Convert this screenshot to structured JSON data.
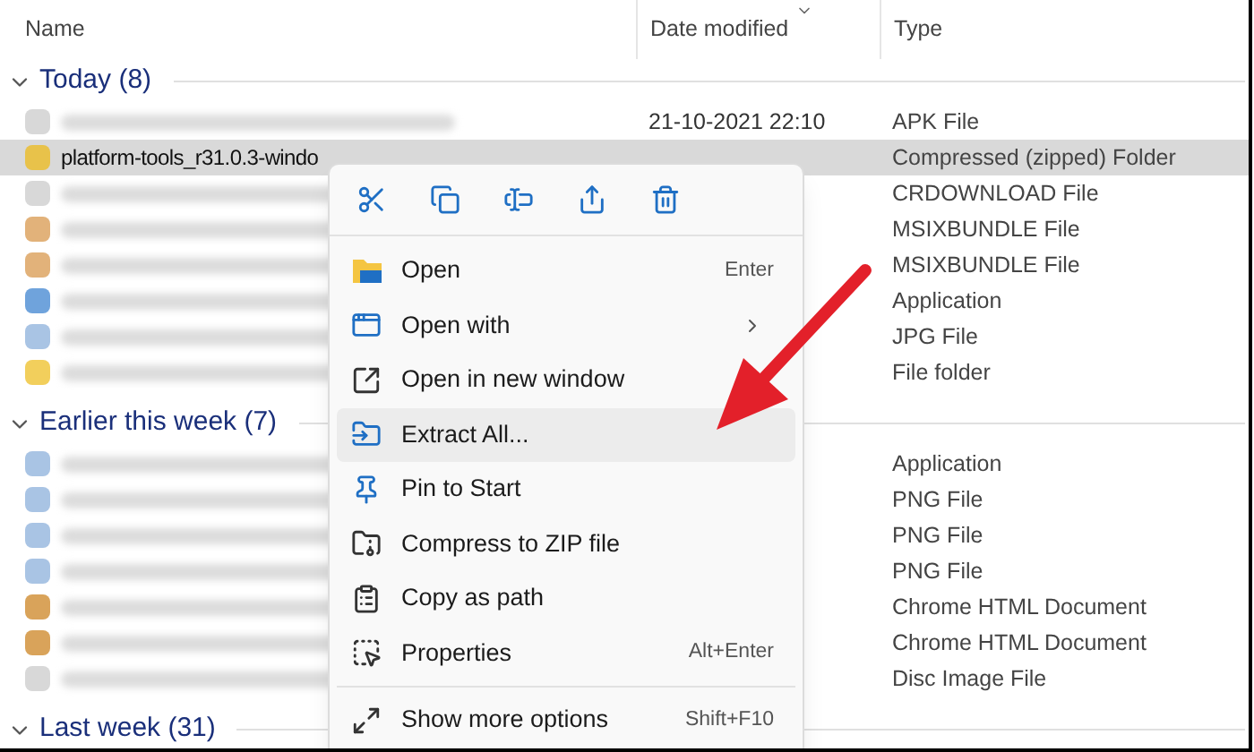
{
  "columns": [
    {
      "label": "Name"
    },
    {
      "label": "Date modified",
      "sorted": true
    },
    {
      "label": "Type"
    }
  ],
  "groups": [
    {
      "label": "Today (8)",
      "expanded": true,
      "rows": [
        {
          "date": "21-10-2021 22:10",
          "type": "APK File",
          "color": "#d8d8d8",
          "selected": false
        },
        {
          "name": "platform-tools_r31.0.3-windo",
          "type": "Compressed (zipped) Folder",
          "color": "#e8c24a",
          "selected": true
        },
        {
          "type": "CRDOWNLOAD File",
          "color": "#d8d8d8",
          "selected": false
        },
        {
          "type": "MSIXBUNDLE File",
          "color": "#e2b27a",
          "selected": false
        },
        {
          "type": "MSIXBUNDLE File",
          "color": "#e2b27a",
          "selected": false
        },
        {
          "type": "Application",
          "color": "#6fa3dc",
          "selected": false
        },
        {
          "type": "JPG File",
          "color": "#a9c4e4",
          "selected": false
        },
        {
          "type": "File folder",
          "color": "#f2cf5c",
          "selected": false
        }
      ]
    },
    {
      "label": "Earlier this week (7)",
      "expanded": true,
      "rows": [
        {
          "type": "Application",
          "color": "#a9c4e4",
          "selected": false
        },
        {
          "type": "PNG File",
          "color": "#a9c4e4",
          "selected": false
        },
        {
          "type": "PNG File",
          "color": "#a9c4e4",
          "selected": false
        },
        {
          "type": "PNG File",
          "color": "#a9c4e4",
          "selected": false
        },
        {
          "type": "Chrome HTML Document",
          "color": "#d9a35a",
          "selected": false
        },
        {
          "type": "Chrome HTML Document",
          "color": "#d9a35a",
          "selected": false
        },
        {
          "type": "Disc Image File",
          "color": "#d8d8d8",
          "selected": false
        }
      ]
    },
    {
      "label": "Last week (31)",
      "expanded": true
    }
  ],
  "context_menu": {
    "toolbar": [
      {
        "kind": "cut"
      },
      {
        "kind": "copy"
      },
      {
        "kind": "rename"
      },
      {
        "kind": "share"
      },
      {
        "kind": "delete"
      }
    ],
    "items": [
      {
        "label": "Open",
        "shortcut": "Enter",
        "selected": false
      },
      {
        "label": "Open with",
        "submenu": true,
        "selected": false
      },
      {
        "label": "Open in new window",
        "selected": false
      },
      {
        "label": "Extract All...",
        "selected": true
      },
      {
        "label": "Pin to Start",
        "selected": false
      },
      {
        "label": "Compress to ZIP file",
        "selected": false
      },
      {
        "label": "Copy as path",
        "selected": false
      },
      {
        "label": "Properties",
        "shortcut": "Alt+Enter",
        "selected": false
      },
      {
        "label": "Show more options",
        "shortcut": "Shift+F10",
        "selected": false,
        "separator_before": true
      }
    ]
  }
}
